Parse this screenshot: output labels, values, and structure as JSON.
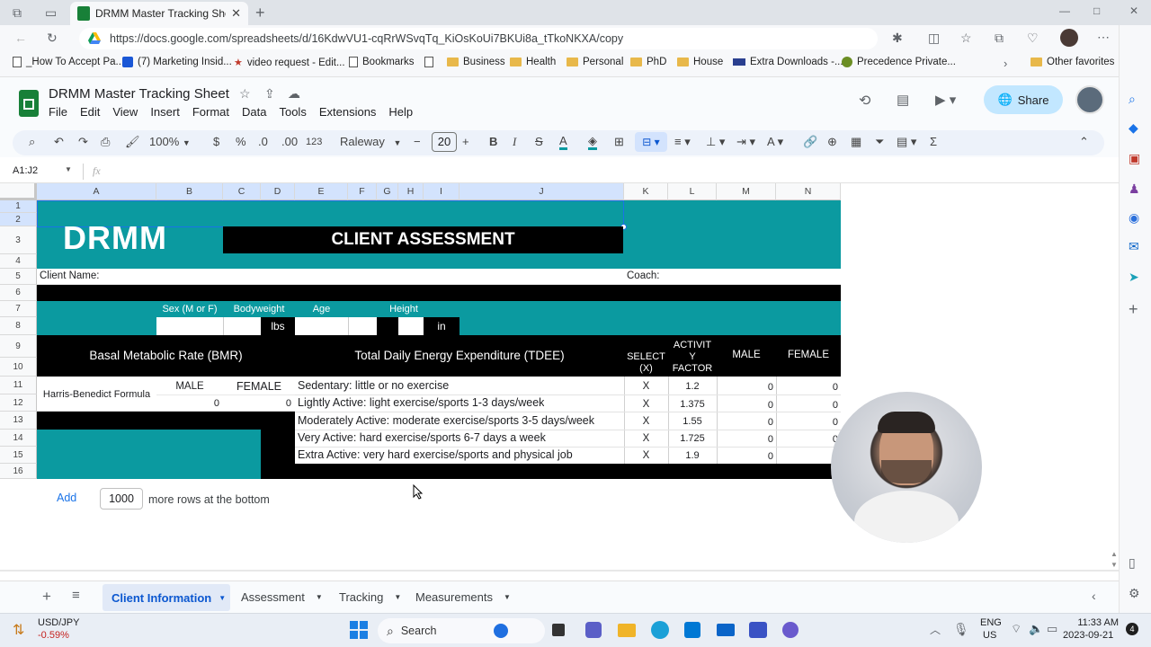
{
  "browser": {
    "tab_title": "DRMM Master Tracking Sheet - G",
    "url": "https://docs.google.com/spreadsheets/d/16KdwVU1-cqRrWSvqTq_KiOsKoUi7BKUi8a_tTkoNKXA/copy",
    "bookmarks": [
      "_How To Accept Pa...",
      "(7) Marketing Insid...",
      "video request - Edit...",
      "Bookmarks",
      "Business",
      "Health",
      "Personal",
      "PhD",
      "House",
      "Extra Downloads -...",
      "Precedence Private..."
    ],
    "other_favorites": "Other favorites"
  },
  "sheets": {
    "doc_title": "DRMM Master Tracking Sheet",
    "menu": [
      "File",
      "Edit",
      "View",
      "Insert",
      "Format",
      "Data",
      "Tools",
      "Extensions",
      "Help"
    ],
    "share_label": "Share",
    "toolbar": {
      "zoom": "100%",
      "currency": "$",
      "percent": "%",
      "dec_less": ".0",
      "dec_more": ".00",
      "format_123": "123",
      "font": "Raleway",
      "font_size": "20",
      "minus": "−",
      "plus": "+"
    },
    "name_box": "A1:J2",
    "fx": "fx",
    "columns": [
      "A",
      "B",
      "C",
      "D",
      "E",
      "F",
      "G",
      "H",
      "I",
      "J",
      "K",
      "L",
      "M",
      "N"
    ],
    "rows": [
      "1",
      "2",
      "3",
      "4",
      "5",
      "6",
      "7",
      "8",
      "9",
      "10",
      "11",
      "12",
      "13",
      "14",
      "15",
      "16"
    ]
  },
  "assessment": {
    "logo": "DRMM",
    "banner": "CLIENT ASSESSMENT",
    "client_name_label": "Client Name:",
    "coach_label": "Coach:",
    "sex_label": "Sex (M or F)",
    "bodyweight_label": "Bodyweight",
    "age_label": "Age",
    "height_label": "Height",
    "lbs": "lbs",
    "in": "in",
    "bmr_header": "Basal Metabolic Rate (BMR)",
    "tdee_header": "Total Daily Energy Expenditure (TDEE)",
    "select_header": "SELECT (X)",
    "activity_header": "ACTIVIT Y FACTOR",
    "male_header": "MALE",
    "female_header": "FEMALE",
    "formula_label": "Harris-Benedict Formula",
    "bmr_male_label": "MALE",
    "bmr_female_label": "FEMALE",
    "bmr_male_value": "0",
    "bmr_female_value": "0",
    "activities": [
      {
        "label": "Sedentary: little or no exercise",
        "select": "X",
        "factor": "1.2",
        "male": "0",
        "female": "0"
      },
      {
        "label": "Lightly Active: light exercise/sports 1-3 days/week",
        "select": "X",
        "factor": "1.375",
        "male": "0",
        "female": "0"
      },
      {
        "label": "Moderately Active: moderate exercise/sports 3-5 days/week",
        "select": "X",
        "factor": "1.55",
        "male": "0",
        "female": "0"
      },
      {
        "label": "Very Active: hard exercise/sports 6-7 days a week",
        "select": "X",
        "factor": "1.725",
        "male": "0",
        "female": "0"
      },
      {
        "label": "Extra Active: very hard exercise/sports and physical job",
        "select": "X",
        "factor": "1.9",
        "male": "0",
        "female": ""
      }
    ]
  },
  "addrows": {
    "add_label": "Add",
    "count": "1000",
    "suffix": "more rows at the bottom"
  },
  "sheet_tabs": [
    "Client Information",
    "Assessment",
    "Tracking",
    "Measurements"
  ],
  "taskbar": {
    "ticker": "USD/JPY",
    "change": "-0.59%",
    "search": "Search",
    "lang1": "ENG",
    "lang2": "US",
    "time": "11:33 AM",
    "date": "2023-09-21",
    "badge": "4"
  },
  "colors": {
    "teal": "#0b9aa0",
    "black": "#000000",
    "accent": "#1a73e8",
    "sheets_green": "#188038"
  }
}
